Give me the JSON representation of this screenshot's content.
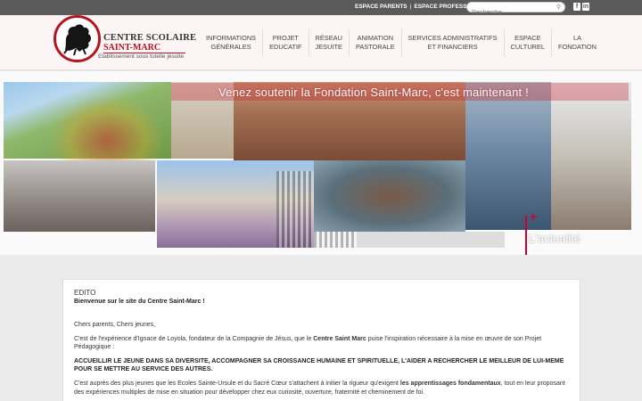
{
  "topbar": {
    "espace_parents": "ESPACE PARENTS",
    "espace_professeurs": "ESPACE PROFESSEURS",
    "search_placeholder": "Recherche"
  },
  "logo": {
    "title_line1": "CENTRE SCOLAIRE",
    "title_line2": "SAINT-MARC",
    "subtitle": "Etablissement sous tutelle jésuite"
  },
  "nav": {
    "items": [
      {
        "line1": "INFORMATIONS",
        "line2": "GÉNÉRALES"
      },
      {
        "line1": "PROJET",
        "line2": "EDUCATIF"
      },
      {
        "line1": "RÉSEAU",
        "line2": "JESUITE"
      },
      {
        "line1": "ANIMATION",
        "line2": "PASTORALE"
      },
      {
        "line1": "SERVICES ADMINISTRATIFS",
        "line2": "ET FINANCIERS"
      },
      {
        "line1": "ESPACE",
        "line2": "CULTUREL"
      },
      {
        "line1": "LA",
        "line2": "FONDATION"
      }
    ]
  },
  "banner": {
    "headline": "Venez soutenir la Fondation Saint-Marc, c'est maintenant !",
    "actualite": "L'actualité"
  },
  "edito": {
    "title": "EDITO",
    "subtitle": "Bienvenue sur le site du Centre Saint-Marc !",
    "greeting": "Chers parents, Chers jeunes,",
    "p1_before": "C'est de l'expérience d'Ignace de Loyola, fondateur de la Compagnie de Jésus, que le ",
    "p1_bold": "Centre Saint Marc",
    "p1_after": " puise l'inspiration nécessaire à la mise en œuvre de son Projet Pédagogique :",
    "caps": "ACCUEILLIR LE JEUNE DANS SA DIVERSITE, ACCOMPAGNER SA CROISSANCE HUMAINE ET SPIRITUELLE, L'AIDER A RECHERCHER LE MEILLEUR DE LUI-MEME POUR SE METTRE AU SERVICE DES AUTRES.",
    "p2_before": "C'est auprès des plus jeunes que les Ecoles Sainte-Ursule et du Sacré Cœur s'attachent à initier la rigueur qu'exigent ",
    "p2_bold": "les apprentissages fondamentaux",
    "p2_after": ", tout en leur proposant des expériences multiples de mise en situation pour développer chez eux curiosité, ouverture, fraternité et cheminement de foi."
  },
  "colors": {
    "topbar": "#5a5a5a",
    "brand_red": "#b31622",
    "header_bg": "#fdf4f5"
  }
}
